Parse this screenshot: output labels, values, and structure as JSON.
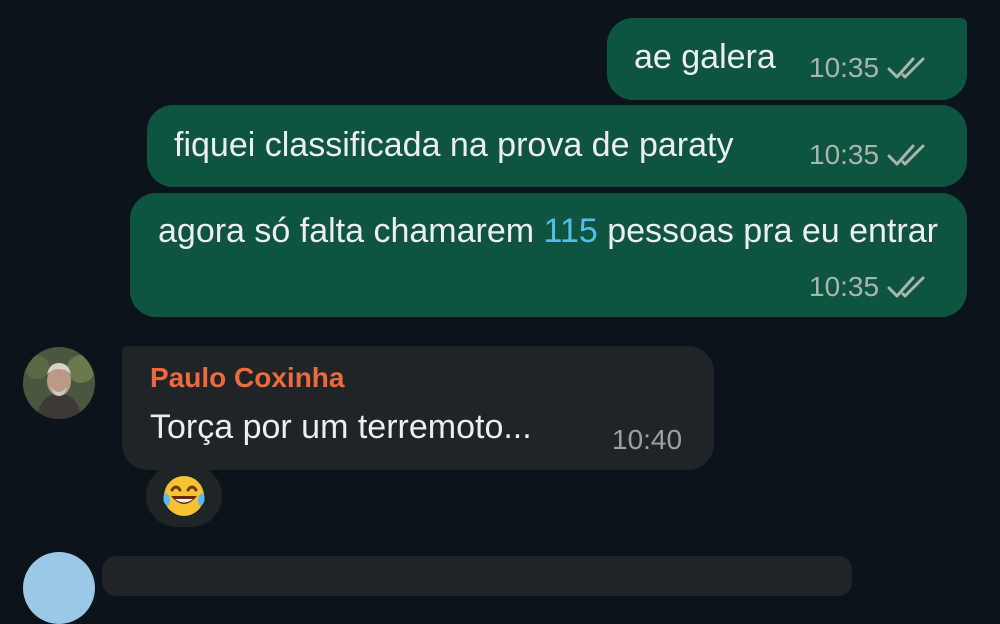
{
  "messages_out": [
    {
      "text": "ae galera",
      "time": "10:35"
    },
    {
      "text": "fiquei classificada na prova de paraty",
      "time": "10:35"
    },
    {
      "text_before": "agora só falta chamarem ",
      "text_highlight": "115",
      "text_after": " pessoas pra eu entrar",
      "time": "10:35"
    }
  ],
  "message_in": {
    "sender": "Paulo Coxinha",
    "text": "Torça por um terremoto...",
    "time": "10:40"
  },
  "reaction": {
    "emoji": "😂",
    "icon": "laughing-tears-emoji"
  },
  "colors": {
    "background": "#0b141b",
    "outgoing_bubble": "#0f5440",
    "incoming_bubble": "#1f2427",
    "sender_name": "#f0693d",
    "link_number": "#53bdeb"
  }
}
